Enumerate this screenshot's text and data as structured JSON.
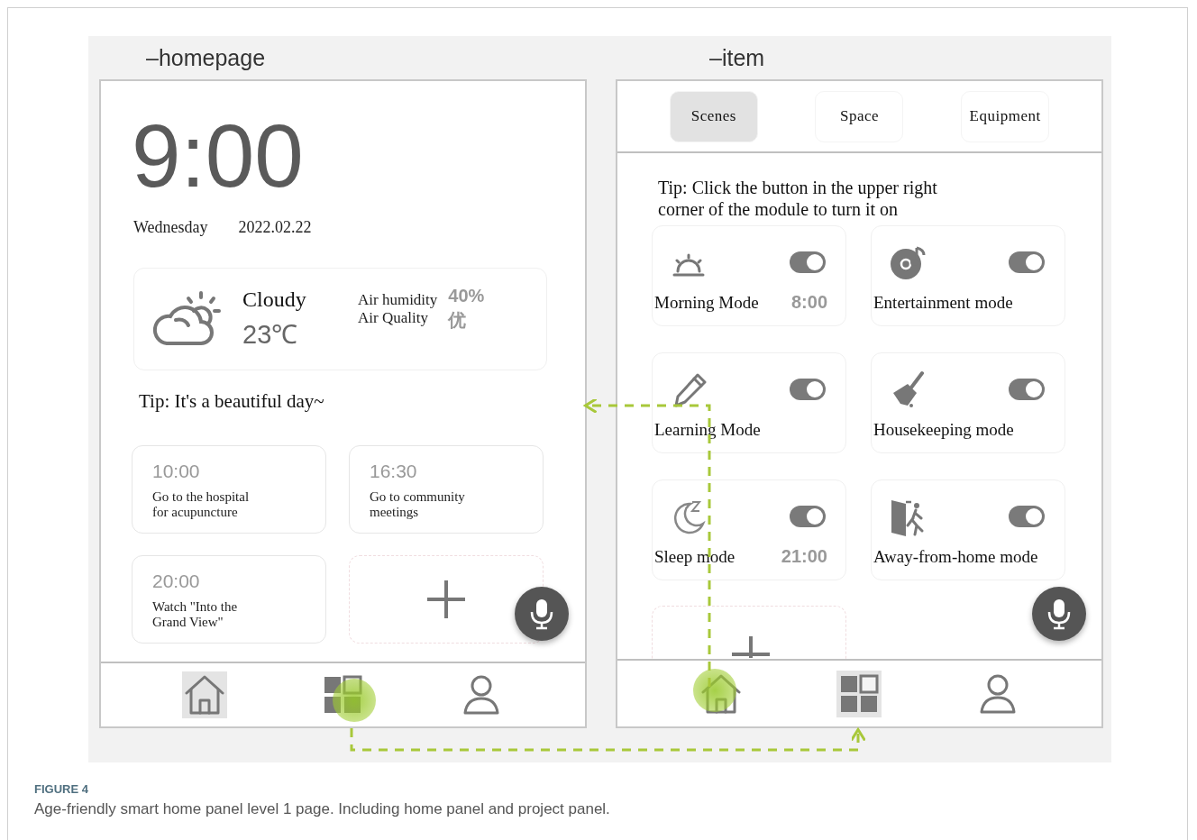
{
  "figure": {
    "homepage": {
      "title": "–homepage",
      "clock": "9:00",
      "weekday": "Wednesday",
      "date": "2022.02.22",
      "weather": {
        "condition": "Cloudy",
        "temperature": "23℃",
        "humidity_label": "Air humidity",
        "humidity": "40%",
        "quality_label": "Air Quality",
        "quality": "优"
      },
      "tip": "Tip: It's a beautiful day~",
      "reminders": [
        {
          "time": "10:00",
          "text": "Go to the hospital\nfor acupuncture"
        },
        {
          "time": "16:30",
          "text": "Go to community\nmeetings"
        },
        {
          "time": "20:00",
          "text": "Watch \"Into the\nGrand View\""
        }
      ],
      "nav": [
        {
          "kind": "home",
          "selected": true,
          "tapped": false
        },
        {
          "kind": "apps",
          "selected": false,
          "tapped": true
        },
        {
          "kind": "profile",
          "selected": false,
          "tapped": false
        }
      ]
    },
    "item_page": {
      "title": "–item",
      "tabs": [
        {
          "label": "Scenes",
          "selected": true
        },
        {
          "label": "Space",
          "selected": false
        },
        {
          "label": "Equipment",
          "selected": false
        }
      ],
      "tip": "Tip: Click the button in the upper right\ncorner of the module to turn it on",
      "modes": [
        {
          "name": "Morning Mode",
          "time": "8:00",
          "on": true
        },
        {
          "name": "Entertainment mode",
          "on": true
        },
        {
          "name": "Learning Mode",
          "on": true
        },
        {
          "name": "Housekeeping mode",
          "on": true
        },
        {
          "name": "Sleep mode",
          "time": "21:00",
          "on": true
        },
        {
          "name": "Away-from-home mode",
          "on": true
        }
      ],
      "nav": [
        {
          "kind": "home",
          "selected": false,
          "tapped": true
        },
        {
          "kind": "apps",
          "selected": true,
          "tapped": false
        },
        {
          "kind": "profile",
          "selected": false,
          "tapped": false
        }
      ]
    },
    "caption": {
      "label": "FIGURE 4",
      "text": "Age-friendly smart home panel level 1 page. Including home panel and project panel."
    }
  }
}
